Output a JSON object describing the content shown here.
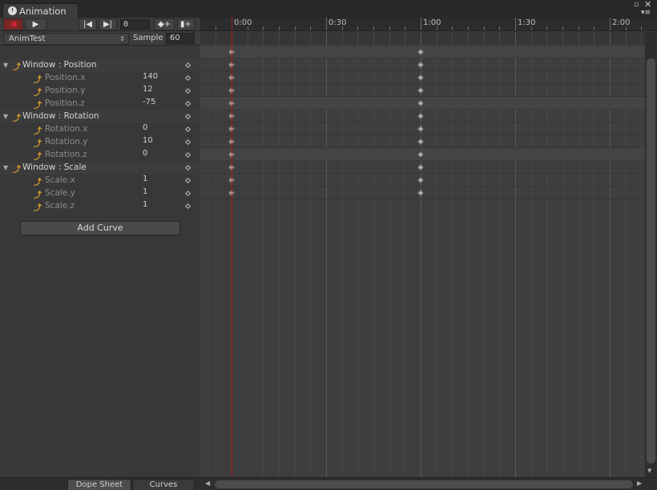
{
  "window": {
    "tab_title": "Animation",
    "maximize_glyph": "▫",
    "close_glyph": "✕",
    "menu_glyph": "▾≡"
  },
  "toolbar": {
    "play_glyph": "▶",
    "prev_key_glyph": "|◀",
    "next_key_glyph": "▶|",
    "frame": "0",
    "add_keyframe_glyph": "◆+",
    "add_event_glyph": "▮+"
  },
  "clip": {
    "name": "AnimTest",
    "arrow_glyph": "⇕",
    "sample_label": "Sample",
    "sample_value": "60"
  },
  "hierarchy": {
    "foldout_glyph": "▼",
    "curve_glyph": "⤴",
    "rows": [
      {
        "kind": "group",
        "label": "Window : Position",
        "value": ""
      },
      {
        "kind": "prop",
        "label": "Position.x",
        "value": "140"
      },
      {
        "kind": "prop",
        "label": "Position.y",
        "value": "12"
      },
      {
        "kind": "prop",
        "label": "Position.z",
        "value": "-75"
      },
      {
        "kind": "group",
        "label": "Window : Rotation",
        "value": ""
      },
      {
        "kind": "prop",
        "label": "Rotation.x",
        "value": "0"
      },
      {
        "kind": "prop",
        "label": "Rotation.y",
        "value": "10"
      },
      {
        "kind": "prop",
        "label": "Rotation.z",
        "value": "0"
      },
      {
        "kind": "group",
        "label": "Window : Scale",
        "value": ""
      },
      {
        "kind": "prop",
        "label": "Scale.x",
        "value": "1"
      },
      {
        "kind": "prop",
        "label": "Scale.y",
        "value": "1"
      },
      {
        "kind": "prop",
        "label": "Scale.z",
        "value": "1"
      }
    ],
    "add_curve_label": "Add Curve"
  },
  "timeline": {
    "ruler_labels": [
      "0:00",
      "0:30",
      "1:00",
      "1:30",
      "2:00"
    ],
    "ruler_label_times": [
      0,
      30,
      60,
      90,
      120
    ],
    "keyframe_times": [
      0,
      60
    ],
    "playhead_time": 0
  },
  "bottom": {
    "dope_sheet_label": "Dope Sheet",
    "curves_label": "Curves",
    "scroll_left_glyph": "◀",
    "scroll_right_glyph": "▶",
    "scroll_down_glyph": "▼"
  },
  "colors": {
    "record": "#c22233",
    "playhead": "#b01d1d",
    "curve_icon": "#e0a030"
  }
}
